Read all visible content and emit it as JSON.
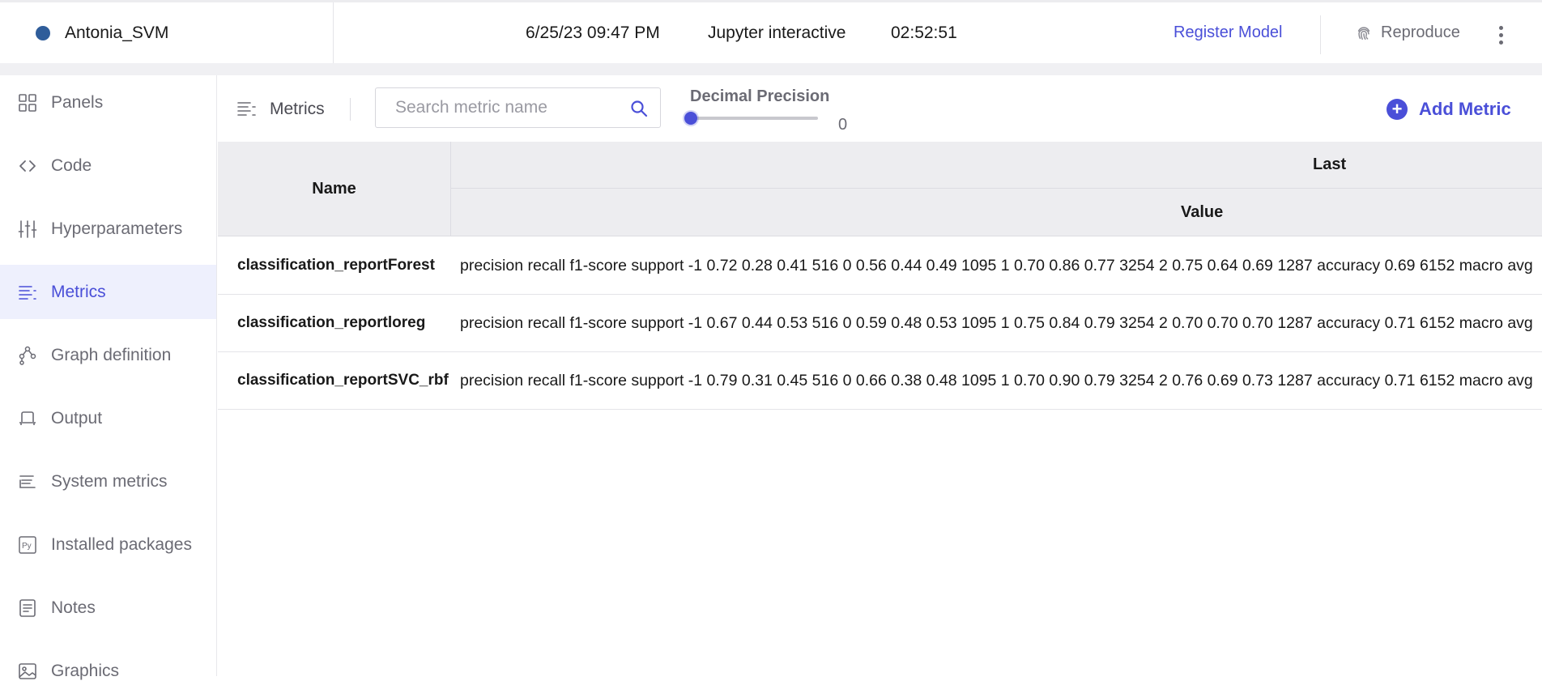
{
  "header": {
    "experiment_name": "Antonia_SVM",
    "status_color": "#2f5d9a",
    "date": "6/25/23 09:47 PM",
    "environment": "Jupyter interactive",
    "duration": "02:52:51",
    "register_label": "Register Model",
    "reproduce_label": "Reproduce"
  },
  "sidebar": {
    "items": [
      {
        "label": "Panels",
        "icon": "panels-icon"
      },
      {
        "label": "Code",
        "icon": "code-icon"
      },
      {
        "label": "Hyperparameters",
        "icon": "sliders-icon"
      },
      {
        "label": "Metrics",
        "icon": "metrics-icon",
        "active": true
      },
      {
        "label": "Graph definition",
        "icon": "graph-icon"
      },
      {
        "label": "Output",
        "icon": "output-icon"
      },
      {
        "label": "System metrics",
        "icon": "system-metrics-icon"
      },
      {
        "label": "Installed packages",
        "icon": "python-icon"
      },
      {
        "label": "Notes",
        "icon": "notes-icon"
      },
      {
        "label": "Graphics",
        "icon": "image-icon"
      }
    ]
  },
  "toolbar": {
    "title": "Metrics",
    "search_placeholder": "Search metric name",
    "decimal_precision_label": "Decimal Precision",
    "decimal_precision_value": "0",
    "decimal_precision_fraction": 0,
    "add_metric_label": "Add Metric"
  },
  "table": {
    "name_header": "Name",
    "group_header": "Last",
    "value_header": "Value",
    "rows": [
      {
        "name": "classification_reportForest",
        "value": "precision recall f1-score support -1 0.72 0.28 0.41 516 0 0.56 0.44 0.49 1095 1 0.70 0.86 0.77 3254 2 0.75 0.64 0.69 1287 accuracy 0.69 6152 macro avg"
      },
      {
        "name": "classification_reportloreg",
        "value": "precision recall f1-score support -1 0.67 0.44 0.53 516 0 0.59 0.48 0.53 1095 1 0.75 0.84 0.79 3254 2 0.70 0.70 0.70 1287 accuracy 0.71 6152 macro avg"
      },
      {
        "name": "classification_reportSVC_rbf",
        "value": "precision recall f1-score support -1 0.79 0.31 0.45 516 0 0.66 0.38 0.48 1095 1 0.70 0.90 0.79 3254 2 0.76 0.69 0.73 1287 accuracy 0.71 6152 macro avg"
      }
    ]
  },
  "colors": {
    "accent": "#4a4fd8",
    "active_bg": "#eef0fd",
    "header_bg": "#ededf0"
  }
}
